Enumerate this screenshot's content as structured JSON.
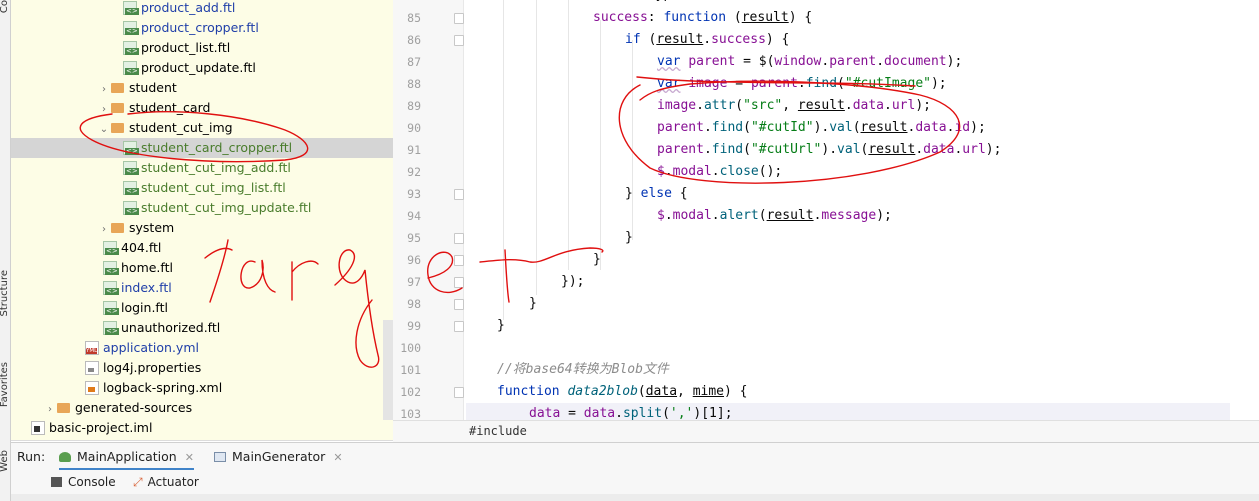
{
  "left_strip": [
    "Structure",
    "Favorites",
    "Web",
    "Co"
  ],
  "tree": [
    {
      "label": "product_add.ftl",
      "type": "ftl",
      "color": "blue",
      "indent": 2
    },
    {
      "label": "product_cropper.ftl",
      "type": "ftl",
      "color": "blue",
      "indent": 2
    },
    {
      "label": "product_list.ftl",
      "type": "ftl",
      "color": "normal",
      "indent": 2
    },
    {
      "label": "product_update.ftl",
      "type": "ftl",
      "color": "normal",
      "indent": 2
    },
    {
      "label": "student",
      "type": "folder",
      "arrow": "›",
      "indent": 1
    },
    {
      "label": "student_card",
      "type": "folder",
      "arrow": "›",
      "indent": 1
    },
    {
      "label": "student_cut_img",
      "type": "folder",
      "arrow": "⌄",
      "indent": 1
    },
    {
      "label": "student_card_cropper.ftl",
      "type": "ftl",
      "color": "green",
      "indent": 2,
      "selected": true
    },
    {
      "label": "student_cut_img_add.ftl",
      "type": "ftl",
      "color": "green",
      "indent": 2
    },
    {
      "label": "student_cut_img_list.ftl",
      "type": "ftl",
      "color": "green",
      "indent": 2
    },
    {
      "label": "student_cut_img_update.ftl",
      "type": "ftl",
      "color": "green",
      "indent": 2
    },
    {
      "label": "system",
      "type": "folder",
      "arrow": "›",
      "indent": 1
    },
    {
      "label": "404.ftl",
      "type": "ftl",
      "color": "normal",
      "indent": 1
    },
    {
      "label": "home.ftl",
      "type": "ftl",
      "color": "normal",
      "indent": 1
    },
    {
      "label": "index.ftl",
      "type": "ftl",
      "color": "blue",
      "indent": 1
    },
    {
      "label": "login.ftl",
      "type": "ftl",
      "color": "normal",
      "indent": 1
    },
    {
      "label": "unauthorized.ftl",
      "type": "ftl",
      "color": "normal",
      "indent": 1
    },
    {
      "label": "application.yml",
      "type": "yml",
      "color": "blue",
      "indent": 0
    },
    {
      "label": "log4j.properties",
      "type": "prop",
      "color": "normal",
      "indent": 0
    },
    {
      "label": "logback-spring.xml",
      "type": "xml",
      "color": "normal",
      "indent": 0
    },
    {
      "label": "generated-sources",
      "type": "folder",
      "arrow": "›",
      "indent": -1
    },
    {
      "label": "basic-project.iml",
      "type": "iml",
      "color": "normal",
      "indent": -2
    }
  ],
  "editor": {
    "line_numbers": [
      "85",
      "86",
      "87",
      "88",
      "89",
      "90",
      "91",
      "92",
      "93",
      "94",
      "95",
      "96",
      "97",
      "98",
      "99",
      "100",
      "101",
      "102",
      "103"
    ],
    "breadcrumb": "#include"
  },
  "run": {
    "label": "Run:",
    "tabs": [
      {
        "label": "MainApplication",
        "active": true
      },
      {
        "label": "MainGenerator",
        "active": false
      }
    ],
    "subtabs": [
      "Console",
      "Actuator"
    ]
  },
  "annotation": {
    "handwriting": "target"
  }
}
